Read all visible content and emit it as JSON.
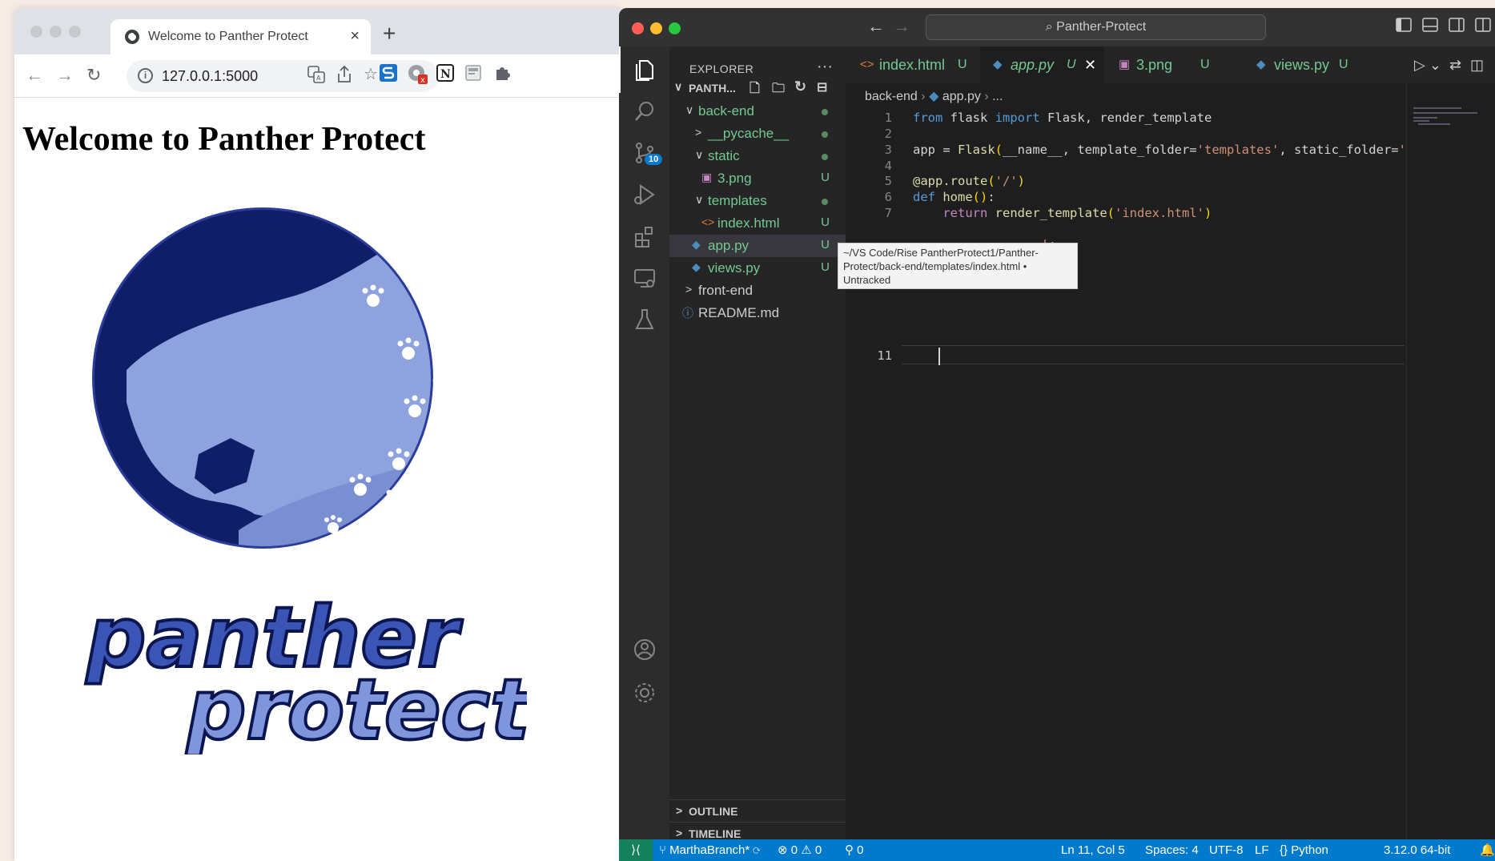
{
  "browser": {
    "tab_title": "Welcome to Panther Protect",
    "tab_close": "×",
    "new_tab": "+",
    "url": "127.0.0.1:5000",
    "heading": "Welcome to Panther Protect",
    "logo_line1": "panther",
    "logo_line2": "protect",
    "ext_badge": "x",
    "ext_notion": "N"
  },
  "vscode": {
    "search_text": "Panther-Protect",
    "explorer_title": "EXPLORER",
    "root_folder": "PANTH...",
    "source_control_badge": "10",
    "tree": [
      {
        "label": "back-end",
        "status": "dot"
      },
      {
        "label": "__pycache__",
        "status": "dot"
      },
      {
        "label": "static",
        "status": "dot"
      },
      {
        "label": "3.png",
        "status": "U"
      },
      {
        "label": "templates",
        "status": "dot"
      },
      {
        "label": "index.html",
        "status": "U"
      },
      {
        "label": "app.py",
        "status": "U"
      },
      {
        "label": "views.py",
        "status": "U"
      },
      {
        "label": "front-end",
        "status": ""
      },
      {
        "label": "README.md",
        "status": ""
      }
    ],
    "outline_label": "OUTLINE",
    "timeline_label": "TIMELINE",
    "tabs": [
      {
        "name": "index.html",
        "status": "U"
      },
      {
        "name": "app.py",
        "status": "U"
      },
      {
        "name": "3.png",
        "status": "U"
      },
      {
        "name": "views.py",
        "status": "U"
      }
    ],
    "breadcrumb": {
      "folder": "back-end",
      "file": "app.py",
      "more": "..."
    },
    "line_numbers": [
      "1",
      "2",
      "3",
      "4",
      "5",
      "6",
      "7",
      "11"
    ],
    "code": {
      "l1_from": "from",
      "l1_mod": "flask",
      "l1_import": "import",
      "l1_names": "Flask, render_template",
      "l3_a": "app = ",
      "l3_fn": "Flask",
      "l3_b": "__name__, template_folder=",
      "l3_s1": "'templates'",
      "l3_c": ", static_folder=",
      "l3_s2": "'s",
      "l5_a": "@app.route",
      "l5_s": "'/'",
      "l6_def": "def",
      "l6_fn": "home",
      "l7_ret": "return",
      "l7_fn": "render_template",
      "l7_s": "'index.html'",
      "l8_tail": "_':",
      "l9_tail": ")"
    },
    "tooltip": "~/VS Code/Rise PantherProtect1/Panther-Protect/back-end/templates/index.html • Untracked",
    "status": {
      "branch": "MarthaBranch*",
      "errors": "0",
      "warnings": "0",
      "ports": "0",
      "position": "Ln 11, Col 5",
      "spaces": "Spaces: 4",
      "encoding": "UTF-8",
      "eol": "LF",
      "language": "Python",
      "interpreter": "3.12.0 64-bit"
    }
  }
}
